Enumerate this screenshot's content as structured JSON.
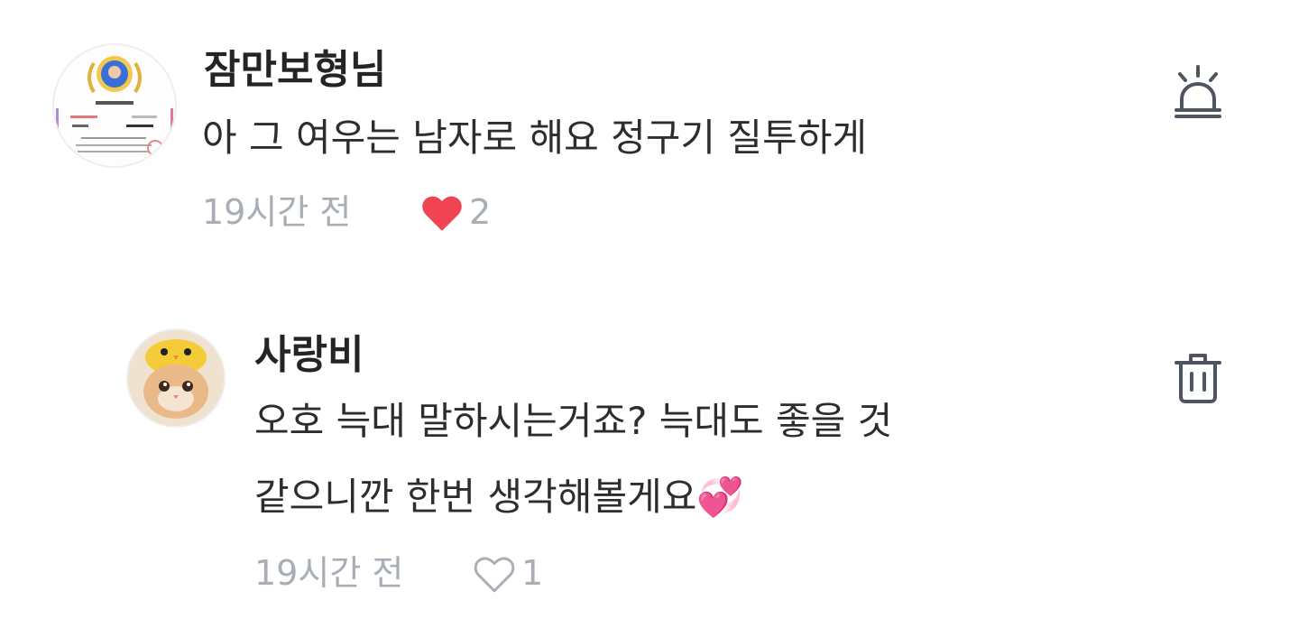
{
  "comments": [
    {
      "author": "잠만보형님",
      "text": "아 그 여우는 남자로 해요 정구기 질투하게",
      "time": "19시간 전",
      "likes": "2",
      "liked": true,
      "action_icon": "report-siren-icon"
    },
    {
      "author": "사랑비",
      "text_line1": "오호 늑대 말하시는거죠? 늑대도 좋을 것",
      "text_line2": "같으니깐 한번 생각해볼게요💞",
      "time": "19시간 전",
      "likes": "1",
      "liked": false,
      "action_icon": "trash-icon"
    }
  ],
  "colors": {
    "heart_filled": "#f04452",
    "muted": "#a8aeb5",
    "icon_stroke": "#4e5460"
  }
}
